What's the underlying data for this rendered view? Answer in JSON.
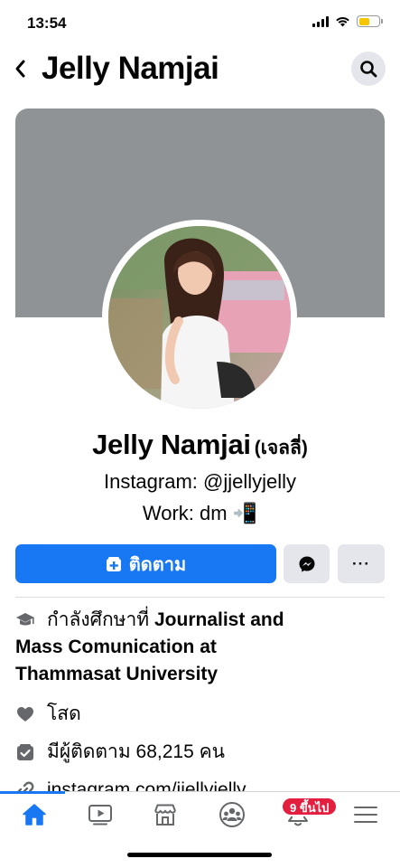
{
  "status_bar": {
    "time": "13:54"
  },
  "header": {
    "title": "Jelly Namjai"
  },
  "profile": {
    "name": "Jelly Namjai",
    "alt_name": "(เจลลี่)",
    "bio_lines": [
      "Instagram: @jjellyjelly",
      "Work: dm 📲"
    ]
  },
  "actions": {
    "follow_label": "ติดตาม",
    "more_label": "···"
  },
  "intro": {
    "education_prefix": "กำลังศึกษาที่ ",
    "education_school_1": "Journalist and",
    "education_school_2": "Mass Comunication at",
    "education_school_3": "Thammasat University",
    "relationship": "โสด",
    "followers": "มีผู้ติดตาม 68,215 คน",
    "link": "instagram.com/jjellyjelly"
  },
  "tabbar": {
    "notification_badge": "9 ขึ้นไป",
    "active_tab": "home"
  },
  "colors": {
    "accent": "#1877f2",
    "badge": "#e41e3f",
    "cover": "#8f9396"
  }
}
